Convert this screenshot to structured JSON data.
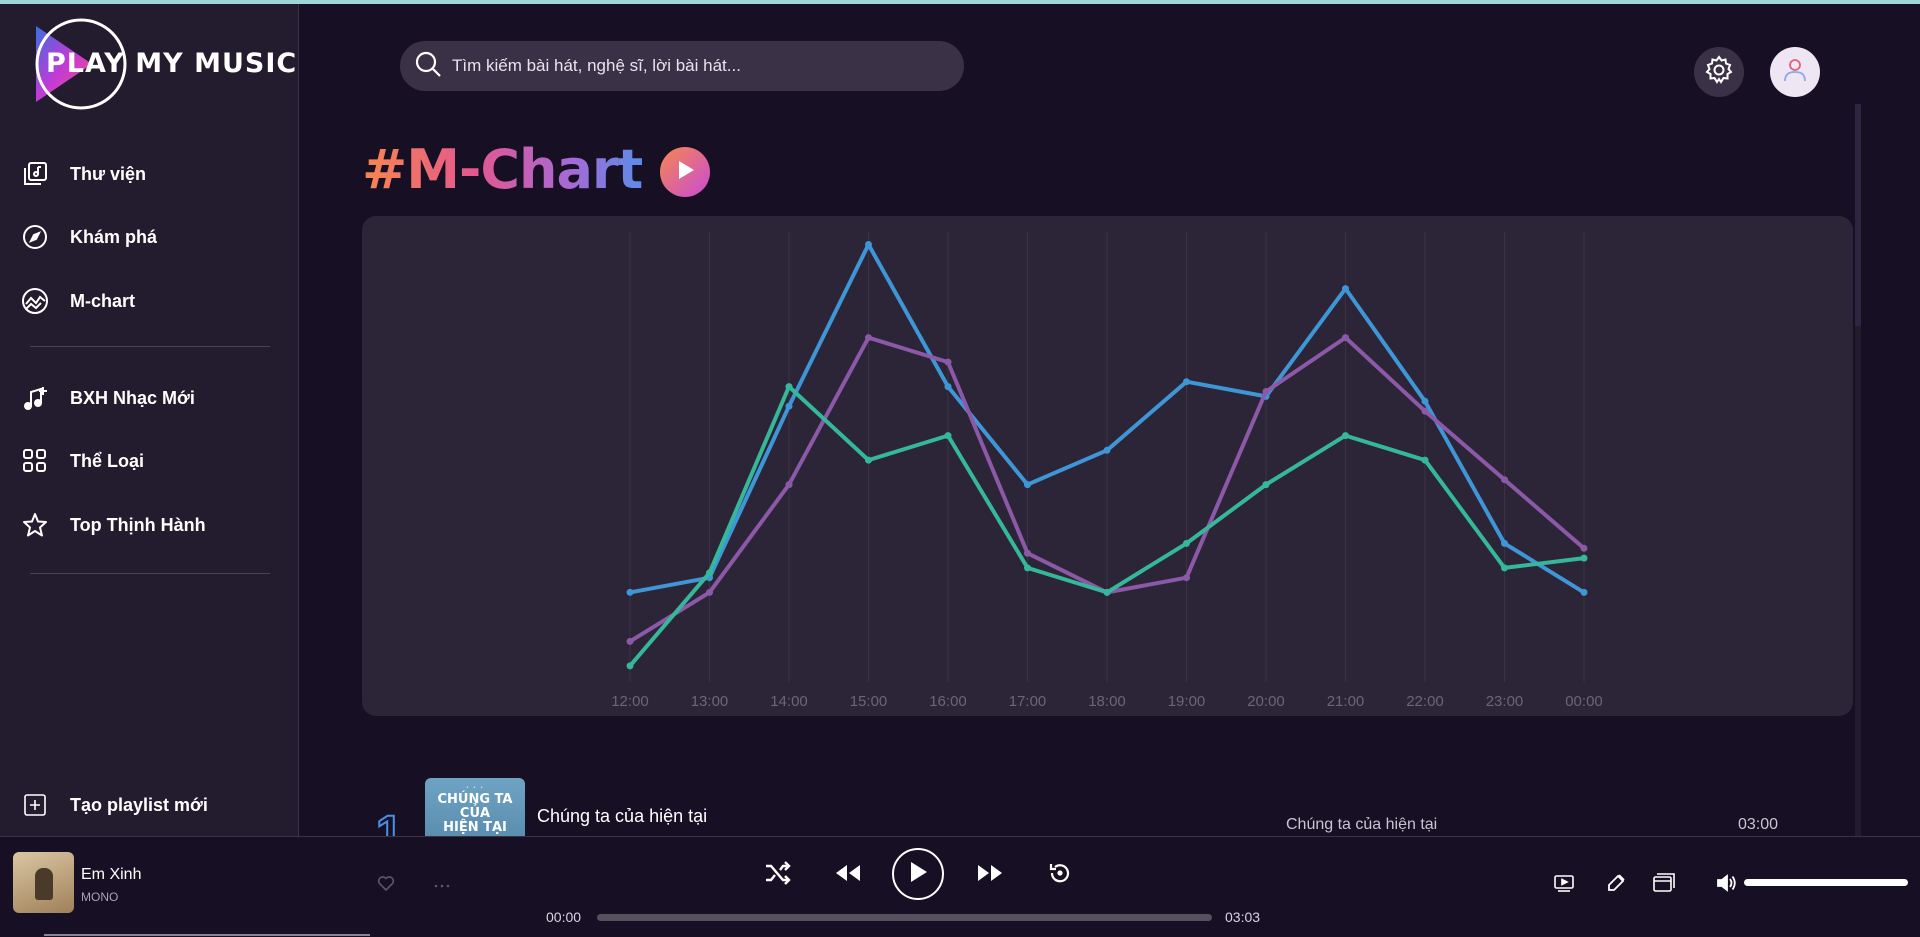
{
  "app": {
    "logo_play": "PLAY",
    "logo_rest": "MY MUSIC"
  },
  "sidebar": {
    "items": [
      {
        "label": "Thư viện",
        "icon": "library-icon"
      },
      {
        "label": "Khám phá",
        "icon": "compass-icon"
      },
      {
        "label": "M-chart",
        "icon": "chart-icon"
      },
      {
        "label": "BXH Nhạc Mới",
        "icon": "music-note-plus-icon"
      },
      {
        "label": "Thể Loại",
        "icon": "grid-icon"
      },
      {
        "label": "Top Thịnh Hành",
        "icon": "star-icon"
      }
    ],
    "create_playlist": "Tạo playlist mới"
  },
  "header": {
    "search_placeholder": "Tìm kiếm bài hát, nghệ sĩ, lời bài hát..."
  },
  "chart_section": {
    "title": "#M-Chart"
  },
  "chart_data": {
    "type": "line",
    "title": "",
    "xlabel": "",
    "ylabel": "",
    "ylim": [
      0,
      100
    ],
    "grid": "vertical",
    "categories": [
      "12:00",
      "13:00",
      "14:00",
      "15:00",
      "16:00",
      "17:00",
      "18:00",
      "19:00",
      "20:00",
      "21:00",
      "22:00",
      "23:00",
      "00:00"
    ],
    "series": [
      {
        "color": "#3f96d6",
        "values": [
          24,
          27,
          62,
          95,
          66,
          46,
          53,
          67,
          64,
          86,
          63,
          34,
          24
        ]
      },
      {
        "color": "#8b59a8",
        "values": [
          14,
          24,
          46,
          76,
          71,
          32,
          24,
          27,
          65,
          76,
          61,
          47,
          33
        ]
      },
      {
        "color": "#35b89a",
        "values": [
          9,
          28,
          66,
          51,
          56,
          29,
          24,
          34,
          46,
          56,
          51,
          29,
          31
        ]
      }
    ]
  },
  "songs": [
    {
      "rank": "1",
      "title": "Chúng ta của hiện tại",
      "album": "Chúng ta của hiện tại",
      "duration": "03:00",
      "cover_text": [
        "CHÚNG TA",
        "CỦA",
        "HIỆN TẠI"
      ]
    }
  ],
  "player": {
    "title": "Em Xinh",
    "artist": "MONO",
    "current_time": "00:00",
    "total_time": "03:03",
    "progress": 0,
    "volume": 1
  }
}
